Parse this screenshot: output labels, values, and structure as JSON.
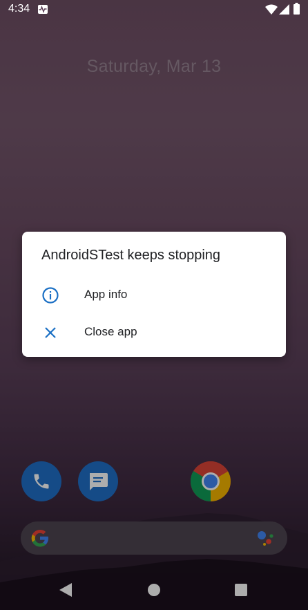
{
  "status_bar": {
    "time": "4:34",
    "icons": [
      "activity-icon",
      "wifi-icon",
      "signal-icon",
      "battery-icon"
    ]
  },
  "lockscreen": {
    "date": "Saturday, Mar 13"
  },
  "dialog": {
    "title": "AndroidSTest keeps stopping",
    "options": [
      {
        "label": "App info",
        "icon": "info-icon"
      },
      {
        "label": "Close app",
        "icon": "close-icon"
      }
    ],
    "accent_color": "#1a6fc4"
  },
  "dock": {
    "apps": [
      "phone",
      "messages",
      "chrome"
    ]
  },
  "search_bar": {
    "icons": [
      "google-logo",
      "assistant-icon"
    ]
  },
  "nav_bar": {
    "buttons": [
      "back",
      "home",
      "recents"
    ]
  }
}
